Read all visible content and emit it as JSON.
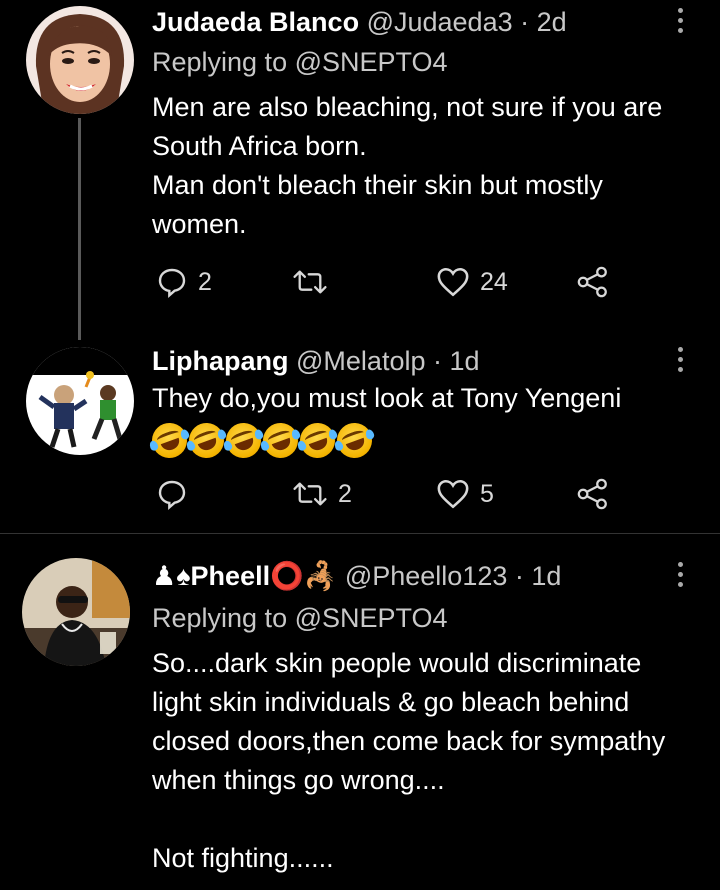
{
  "tweets": [
    {
      "name": "Judaeda Blanco",
      "handle": "@Judaeda3",
      "time": "· 2d",
      "replying_label": "Replying to",
      "replying_handle": "@SNEPTO4",
      "body": "Men are also bleaching, not sure if you are South Africa born.\nMan don't bleach their skin but mostly women.",
      "replies": "2",
      "retweets": "",
      "likes": "24"
    },
    {
      "name": "Liphapang",
      "handle": "@Melatolp",
      "time": "· 1d",
      "body": "They do,you must look at Tony Yengeni",
      "emoji": [
        "rofl",
        "rofl",
        "rofl",
        "rofl",
        "rofl",
        "rofl"
      ],
      "replies": "",
      "retweets": "2",
      "likes": "5"
    },
    {
      "name": "♟♠Pheell⭕🦂",
      "handle": "@Pheello123",
      "time": "· 1d",
      "replying_label": "Replying to",
      "replying_handle": "@SNEPTO4",
      "body": "So....dark skin people would discriminate light skin individuals & go bleach behind closed doors,then come back for sympathy when things go wrong....\n\nNot fighting......"
    }
  ],
  "icons": {
    "reply": "reply-icon",
    "retweet": "retweet-icon",
    "like": "heart-icon",
    "share": "share-icon",
    "more": "more-vertical-icon"
  }
}
